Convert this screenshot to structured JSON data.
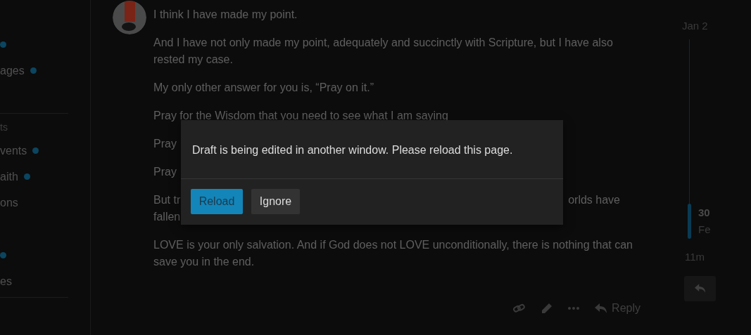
{
  "sidebar": {
    "sections": [
      {
        "items": [
          {
            "unread": true
          },
          {
            "label": "ages",
            "unread": true
          }
        ]
      },
      {
        "header": "ts",
        "items": [
          {
            "label": "vents",
            "unread": true
          },
          {
            "label": "aith",
            "unread": true
          },
          {
            "label": "ons",
            "unread": false
          }
        ]
      },
      {
        "items": [
          {
            "unread": true
          },
          {
            "label": "es",
            "unread": false
          }
        ]
      }
    ]
  },
  "post": {
    "paragraphs": [
      {
        "kind": "text",
        "text": "I think I have made my point."
      },
      {
        "kind": "text",
        "text": "And I have not only made my point, adequately and succinctly with Scripture, but I have also rested my case."
      },
      {
        "kind": "text",
        "text": "My only other answer for you is, “Pray on it.”"
      },
      {
        "kind": "text",
        "text": "Pray for the Wisdom that you need to see what I am saying"
      },
      {
        "kind": "covered",
        "lines": [
          {
            "left": "Pray"
          }
        ]
      },
      {
        "kind": "covered",
        "lines": [
          {
            "left": "Pray"
          }
        ]
      },
      {
        "kind": "covered",
        "lines": [
          {
            "left": "But tr",
            "right": "orlds have"
          },
          {
            "left": "fallen"
          }
        ]
      },
      {
        "kind": "text",
        "text": "LOVE is your only salvation. And if God does not LOVE unconditionally, there is nothing that can save you in the end."
      }
    ],
    "actions": {
      "reply": "Reply"
    }
  },
  "timeline": {
    "start": "Jan 2",
    "current_day": "30",
    "current_month": "Fe",
    "age": "11m"
  },
  "dialog": {
    "message": "Draft is being edited in another window. Please reload this page.",
    "buttons": [
      {
        "label": "Reload",
        "kind": "primary"
      },
      {
        "label": "Ignore",
        "kind": "secondary"
      }
    ]
  }
}
